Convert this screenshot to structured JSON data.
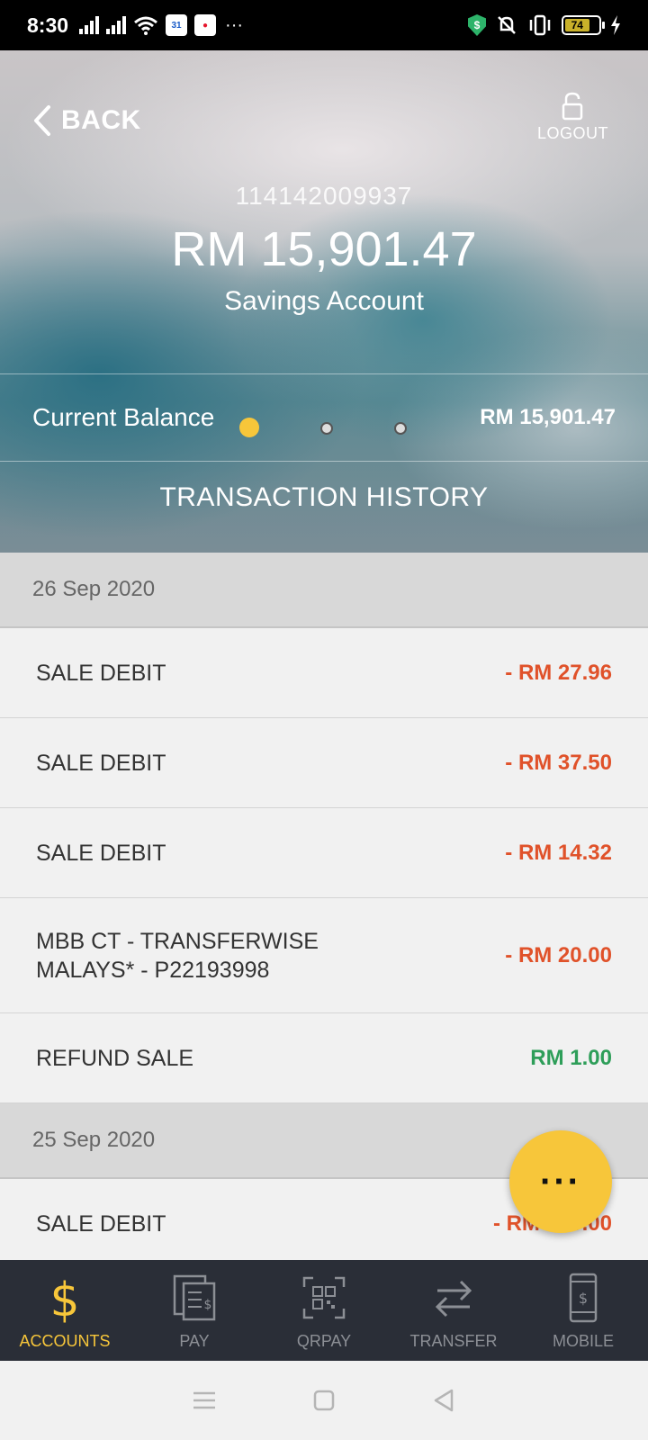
{
  "status_bar": {
    "time": "8:30",
    "more": "···",
    "battery_level": "74"
  },
  "header": {
    "back_label": "BACK",
    "logout_label": "LOGOUT",
    "account_number": "114142009937",
    "account_balance": "RM 15,901.47",
    "account_type": "Savings Account",
    "current_balance_label": "Current Balance",
    "current_balance_amount": "RM 15,901.47",
    "section_title": "TRANSACTION HISTORY"
  },
  "transactions": {
    "group1": {
      "date": "26 Sep 2020",
      "items": [
        {
          "desc": "SALE DEBIT",
          "amount": "- RM 27.96"
        },
        {
          "desc": "SALE DEBIT",
          "amount": "- RM 37.50"
        },
        {
          "desc": "SALE DEBIT",
          "amount": "- RM 14.32"
        },
        {
          "desc_line1": "MBB CT - TRANSFERWISE",
          "desc_line2": "MALAYS* - P22193998",
          "amount": "- RM 20.00"
        },
        {
          "desc": "REFUND SALE",
          "amount": "RM 1.00"
        }
      ]
    },
    "group2": {
      "date": "25 Sep 2020",
      "items": [
        {
          "desc": "SALE DEBIT",
          "amount": "- RM 300.00"
        }
      ]
    }
  },
  "fab": {
    "label": "···"
  },
  "bottom_nav": {
    "items": [
      {
        "label": "ACCOUNTS",
        "icon": "dollar-icon"
      },
      {
        "label": "PAY",
        "icon": "bill-icon"
      },
      {
        "label": "QRPAY",
        "icon": "qr-icon"
      },
      {
        "label": "TRANSFER",
        "icon": "transfer-icon"
      },
      {
        "label": "MOBILE",
        "icon": "mobile-icon"
      }
    ]
  },
  "colors": {
    "accent": "#f7c63a",
    "debit": "#e0522a",
    "credit": "#2e9e59",
    "nav_bg": "#2a2e37"
  }
}
